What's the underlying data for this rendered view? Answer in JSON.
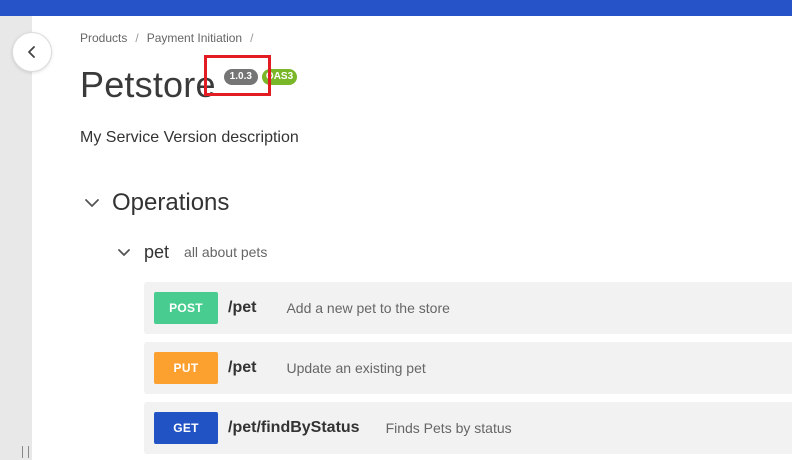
{
  "breadcrumb": {
    "items": [
      "Products",
      "Payment Initiation"
    ],
    "separator": "/"
  },
  "page": {
    "title": "Petstore",
    "version": "1.0.3",
    "spec_badge": "OAS3",
    "description": "My Service Version description"
  },
  "operations_section": {
    "title": "Operations"
  },
  "tag": {
    "name": "pet",
    "description": "all about pets"
  },
  "operations": [
    {
      "method": "POST",
      "path": "/pet",
      "summary": "Add a new pet to the store"
    },
    {
      "method": "PUT",
      "path": "/pet",
      "summary": "Update an existing pet"
    },
    {
      "method": "GET",
      "path": "/pet/findByStatus",
      "summary": "Finds Pets by status"
    }
  ],
  "colors": {
    "topbar": "#2653c7",
    "post": "#49cc90",
    "put": "#fca130",
    "get": "#2153c5",
    "highlight": "#e31b23"
  },
  "icons": {
    "back": "chevron-left-icon",
    "collapse": "chevron-down-icon"
  }
}
